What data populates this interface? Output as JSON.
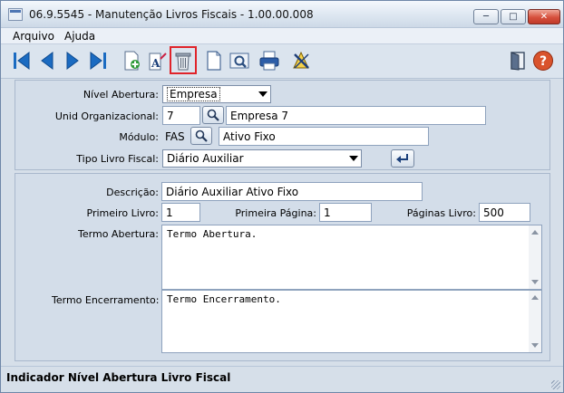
{
  "window": {
    "title": "06.9.5545 - Manutenção Livros Fiscais - 1.00.00.008"
  },
  "window_controls": {
    "minimize": "─",
    "maximize": "□",
    "close": "✕"
  },
  "menu": [
    "Arquivo",
    "Ajuda"
  ],
  "toolbar": {
    "buttons": [
      "first-record-icon",
      "previous-record-icon",
      "next-record-icon",
      "last-record-icon",
      "add-record-icon",
      "edit-record-icon",
      "delete-record-icon",
      "new-document-icon",
      "preview-icon",
      "print-icon",
      "tools-icon",
      "exit-door-icon",
      "help-icon"
    ],
    "help_label": "?",
    "highlighted": "delete-record-icon",
    "edit_letter": "A"
  },
  "form": {
    "nivel_abertura": {
      "label": "Nível Abertura:",
      "value": "Empresa"
    },
    "unid_org": {
      "label": "Unid Organizacional:",
      "code": "7",
      "name": "Empresa 7"
    },
    "modulo": {
      "label": "Módulo:",
      "code": "FAS",
      "name": "Ativo Fixo"
    },
    "tipo_livro": {
      "label": "Tipo Livro Fiscal:",
      "value": "Diário Auxiliar"
    },
    "descricao": {
      "label": "Descrição:",
      "value": "Diário Auxiliar Ativo Fixo"
    },
    "primeiro_livro": {
      "label": "Primeiro Livro:",
      "value": "1"
    },
    "primeira_pagina": {
      "label": "Primeira Página:",
      "value": "1"
    },
    "paginas_livro": {
      "label": "Páginas Livro:",
      "value": "500"
    },
    "termo_abertura": {
      "label": "Termo Abertura:",
      "value": "Termo Abertura."
    },
    "termo_encerramento": {
      "label": "Termo Encerramento:",
      "value": "Termo Encerramento."
    }
  },
  "status": {
    "text": "Indicador Nível Abertura Livro Fiscal"
  },
  "colors": {
    "accent": "#1b6bc1",
    "highlight": "#e0232a",
    "help": "#d9532c"
  }
}
